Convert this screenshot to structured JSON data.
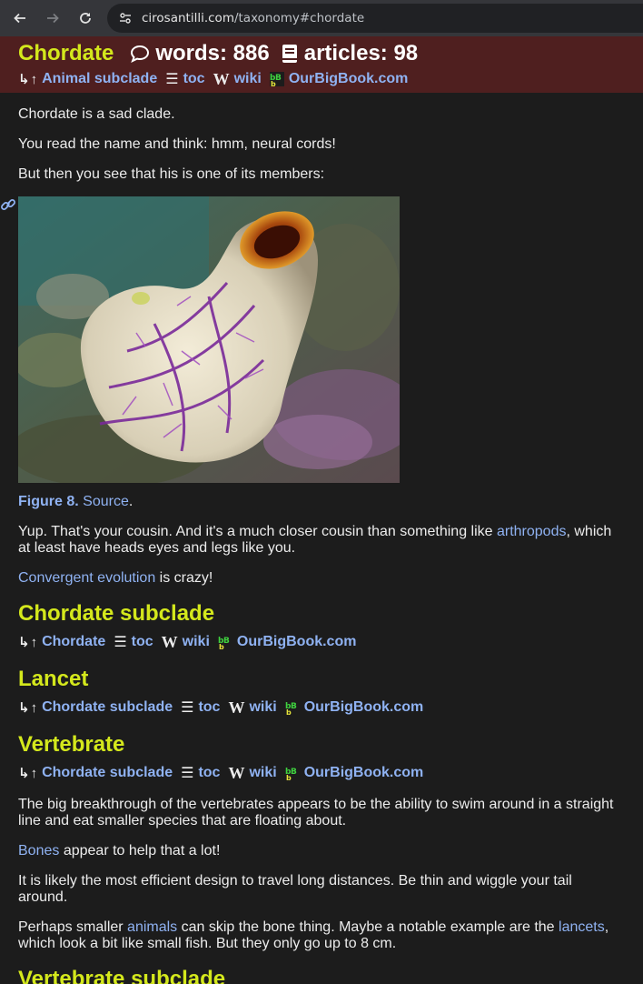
{
  "browser": {
    "url_host": "cirosantilli.com",
    "url_path": "/taxonomy#chordate"
  },
  "header": {
    "title": "Chordate",
    "words_label": "words: 886",
    "articles_label": "articles: 98",
    "nav": {
      "parent": "Animal subclade",
      "toc": "toc",
      "wiki": "wiki",
      "obb": "OurBigBook.com"
    }
  },
  "body": {
    "p1": "Chordate is a sad clade.",
    "p2": "You read the name and think: hmm, neural cords!",
    "p3": "But then you see that his is one of its members:",
    "figure": {
      "label": "Figure 8.",
      "source": "Source",
      "after": "."
    },
    "p4_a": "Yup. That's your cousin. And it's a much closer cousin than something like ",
    "p4_link": "arthropods",
    "p4_b": ", which at least have heads eyes and legs like you.",
    "p5_link": "Convergent evolution",
    "p5_b": " is crazy!"
  },
  "sections": [
    {
      "title": "Chordate subclade",
      "parent": "Chordate",
      "toc": "toc",
      "wiki": "wiki",
      "obb": "OurBigBook.com"
    },
    {
      "title": "Lancet",
      "parent": "Chordate subclade",
      "toc": "toc",
      "wiki": "wiki",
      "obb": "OurBigBook.com"
    },
    {
      "title": "Vertebrate",
      "parent": "Chordate subclade",
      "toc": "toc",
      "wiki": "wiki",
      "obb": "OurBigBook.com"
    },
    {
      "title": "Vertebrate subclade"
    }
  ],
  "vertebrate": {
    "p1": "The big breakthrough of the vertebrates appears to be the ability to swim around in a straight line and eat smaller species that are floating about.",
    "p2_link": "Bones",
    "p2_b": " appear to help that a lot!",
    "p3": "It is likely the most efficient design to travel long distances. Be thin and wiggle your tail around.",
    "p4_a": "Perhaps smaller ",
    "p4_link1": "animals",
    "p4_b": " can skip the bone thing. Maybe a notable example are the ",
    "p4_link2": "lancets",
    "p4_c": ", which look a bit like small fish. But they only go up to 8 cm."
  },
  "colors": {
    "heading": "#d4e81c",
    "link": "#8fb2f2",
    "header_bg": "#4f1f1f",
    "page_bg": "#1c1c1c"
  }
}
